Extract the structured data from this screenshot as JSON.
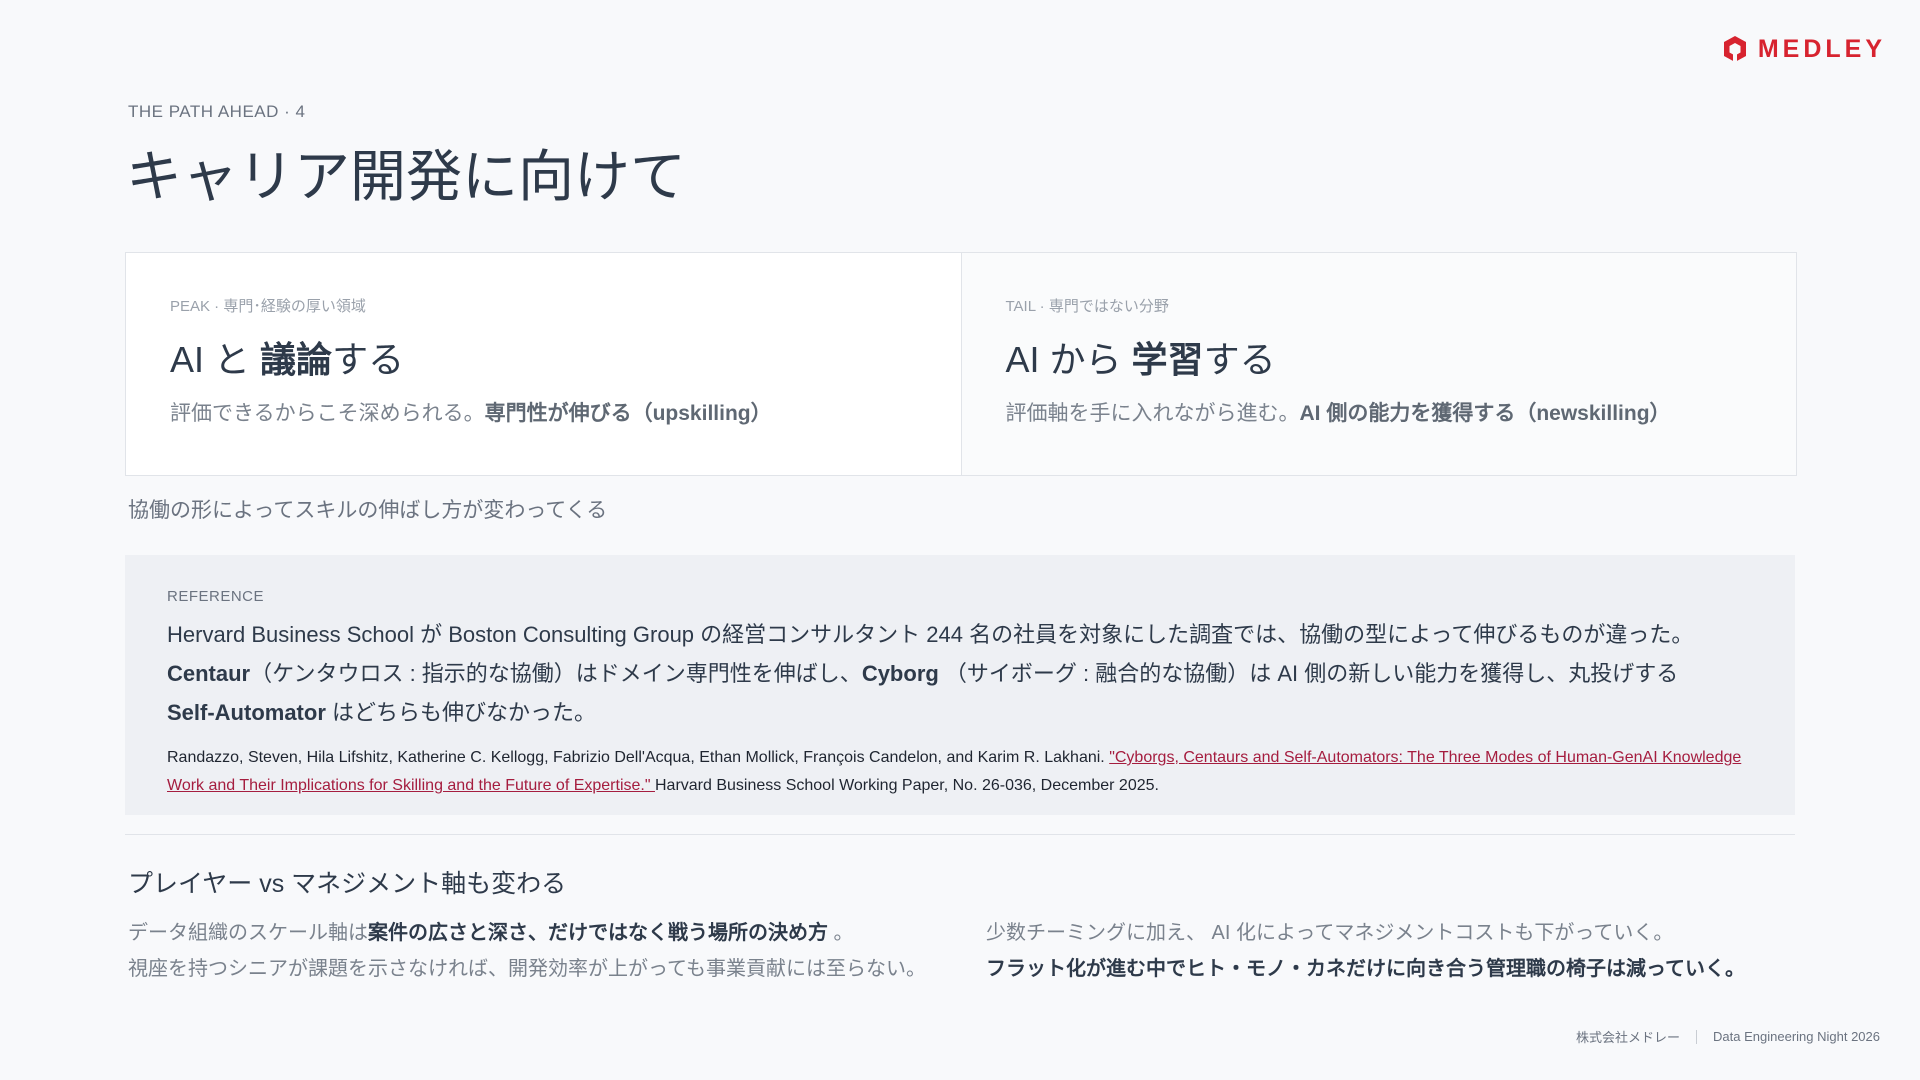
{
  "brand": {
    "name": "MEDLEY",
    "color": "#d7232f"
  },
  "header": {
    "eyebrow": "THE PATH AHEAD · 4",
    "title": "キャリア開発に向けて"
  },
  "cards": [
    {
      "eyebrow": "PEAK · 専門･経験の厚い領域",
      "title_pre": "AI と",
      "title_bold": "議論",
      "title_post": "する",
      "desc": "評価できるからこそ深められる。",
      "desc_bold": "専門性が伸びる（upskilling）"
    },
    {
      "eyebrow": "TAIL · 専門ではない分野",
      "title_pre": "AI から",
      "title_bold": "学習",
      "title_post": "する",
      "desc": "評価軸を手に入れながら進む。",
      "desc_bold": "AI 側の能力を獲得する（newskilling）"
    }
  ],
  "cards_caption": "協働の形によってスキルの伸ばし方が変わってくる",
  "reference": {
    "label": "REFERENCE",
    "line1": "Hervard Business School が Boston Consulting Group の経営コンサルタント 244 名の社員を対象にした調査では、協働の型によって伸びるものが違った。",
    "line2_b1": "Centaur",
    "line2_t1": "（ケンタウロス : 指示的な協働）はドメイン専門性を伸ばし、",
    "line2_b2": "Cyborg",
    "line2_t2": " （サイボーグ : 融合的な協働）は AI 側の新しい能力を獲得し、丸投げする",
    "line3_b": "Self-Automator",
    "line3_t": " はどちらも伸びなかった。",
    "citation_pre": "Randazzo, Steven, Hila Lifshitz, Katherine C. Kellogg, Fabrizio Dell'Acqua, Ethan Mollick, François Candelon, and Karim R. Lakhani. ",
    "citation_link": "\"Cyborgs, Centaurs and Self-Automators: The Three Modes of Human-GenAI Knowledge Work and Their Implications for Skilling and the Future of Expertise.\" ",
    "citation_post": "Harvard Business School Working Paper, No. 26-036, December 2025."
  },
  "section": {
    "title": "プレイヤー vs マネジメント軸も変わる",
    "left_l1_pre": "データ組織のスケール軸は",
    "left_l1_bold": "案件の広さと深さ、だけではなく戦う場所の決め方",
    "left_l1_post": " 。",
    "left_l2": "視座を持つシニアが課題を示さなければ、開発効率が上がっても事業貢献には至らない。",
    "right_l1": "少数チーミングに加え、 AI 化によってマネジメントコストも下がっていく。",
    "right_l2_bold": "フラット化が進む中でヒト・モノ・カネだけに向き合う管理職の椅子は減っていく。"
  },
  "footer": {
    "company": "株式会社メドレー",
    "event": "Data Engineering Night 2026"
  }
}
